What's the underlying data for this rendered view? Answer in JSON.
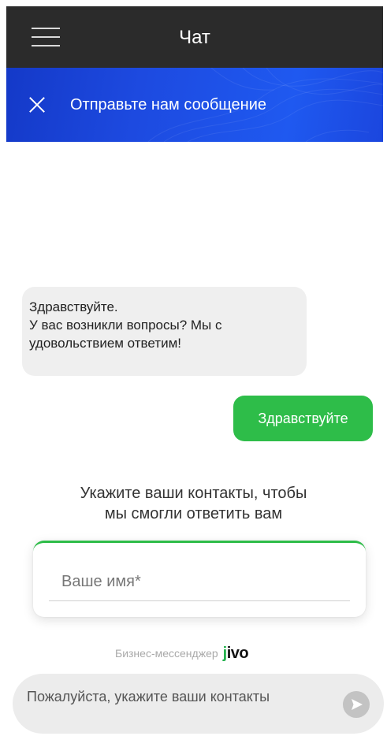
{
  "appbar": {
    "title": "Чат",
    "menu_icon": "hamburger-icon"
  },
  "chat_header": {
    "title": "Отправьте нам сообщение",
    "close_icon": "close-icon",
    "colors": {
      "gradient_start": "#1439c8",
      "gradient_end": "#1f59f0"
    }
  },
  "messages": [
    {
      "from": "operator",
      "lines": [
        "Здравствуйте.",
        "У вас возникли вопросы? Мы с",
        "удовольствием ответим!"
      ]
    },
    {
      "from": "visitor",
      "text": "Здравствуйте"
    }
  ],
  "contact_form": {
    "prompt_lines": [
      "Укажите ваши контакты, чтобы",
      "мы смогли ответить вам"
    ],
    "name_placeholder": "Ваше имя*",
    "name_value": ""
  },
  "branding": {
    "text": "Бизнес-мессенджер",
    "logo": "jivo"
  },
  "composer": {
    "placeholder": "Пожалуйста, укажите ваши контакты",
    "send_icon": "send-icon"
  },
  "colors": {
    "accent_green": "#2ebd49",
    "appbar": "#2b2b2b",
    "bubble_in": "#efefef"
  }
}
